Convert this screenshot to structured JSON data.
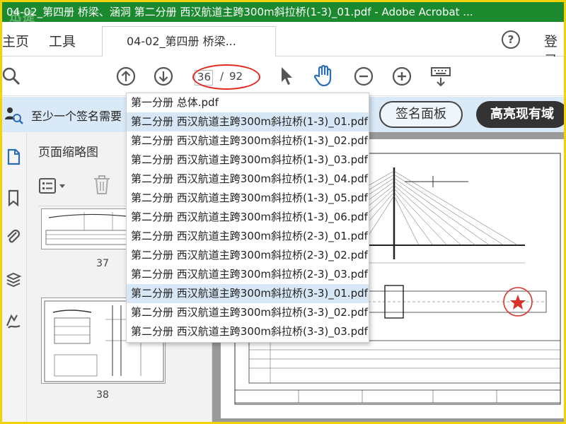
{
  "window": {
    "title": "04-02_第四册 桥梁、涵洞 第二分册 西汉航道主跨300m斜拉桥(1-3)_01.pdf - Adobe Acrobat ...",
    "watermark": "迅捷"
  },
  "menu": {
    "home": "主页",
    "tools": "工具",
    "login": "登录"
  },
  "tab": {
    "label": "04-02_第四册 桥梁..."
  },
  "toolbar": {
    "current_page": "36",
    "separator": "/",
    "total_pages": "92"
  },
  "banner": {
    "message": "至少一个签名需要",
    "sign_panel_button": "签名面板",
    "highlight_button": "高亮现有域"
  },
  "thumbnails": {
    "title": "页面缩略图",
    "pages": [
      "37",
      "38"
    ]
  },
  "dropdown": {
    "items": [
      "第一分册 总体.pdf",
      "第二分册 西汉航道主跨300m斜拉桥(1-3)_01.pdf",
      "第二分册 西汉航道主跨300m斜拉桥(1-3)_02.pdf",
      "第二分册 西汉航道主跨300m斜拉桥(1-3)_03.pdf",
      "第二分册 西汉航道主跨300m斜拉桥(1-3)_04.pdf",
      "第二分册 西汉航道主跨300m斜拉桥(1-3)_05.pdf",
      "第二分册 西汉航道主跨300m斜拉桥(1-3)_06.pdf",
      "第二分册 西汉航道主跨300m斜拉桥(2-3)_01.pdf",
      "第二分册 西汉航道主跨300m斜拉桥(2-3)_02.pdf",
      "第二分册 西汉航道主跨300m斜拉桥(2-3)_03.pdf",
      "第二分册 西汉航道主跨300m斜拉桥(3-3)_01.pdf",
      "第二分册 西汉航道主跨300m斜拉桥(3-3)_02.pdf",
      "第二分册 西汉航道主跨300m斜拉桥(3-3)_03.pdf"
    ],
    "selected": [
      1,
      10
    ]
  },
  "colors": {
    "titlebar": "#1b8a2e",
    "banner": "#d9e9f7",
    "annotation": "#e3261e",
    "frame": "#f2d300",
    "selected_row": "#d7e7f5"
  },
  "icons": [
    "zoom-icon",
    "page-up-icon",
    "page-down-icon",
    "select-cursor-icon",
    "hand-tool-icon",
    "zoom-out-icon",
    "zoom-in-icon",
    "keyboard-icon",
    "help-icon",
    "thumbnails-icon",
    "bookmark-icon",
    "attachment-icon",
    "layers-icon",
    "signature-icon",
    "options-list-icon",
    "trash-icon"
  ]
}
